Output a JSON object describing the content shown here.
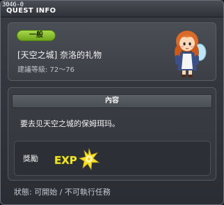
{
  "window": {
    "id": "3046-0",
    "title": "QUEST INFO"
  },
  "quest": {
    "category_badge": "一般",
    "name": "[天空之城] 奈洛的礼物",
    "level_requirement": "建議等級: 72～76",
    "npc_icon": "npc-girl-portrait-icon"
  },
  "content": {
    "section_title": "內容",
    "description": "要去见天空之城的保姆珥玛。"
  },
  "reward": {
    "label": "獎勵",
    "exp_icon": "exp-reward-icon",
    "exp_text": "EXP"
  },
  "status": {
    "text": "狀態: 可開始 / 不可執行任務"
  },
  "colors": {
    "badge_green": "#8cc232",
    "exp_yellow": "#f4e22a",
    "panel_bg": "#3c3f46"
  }
}
